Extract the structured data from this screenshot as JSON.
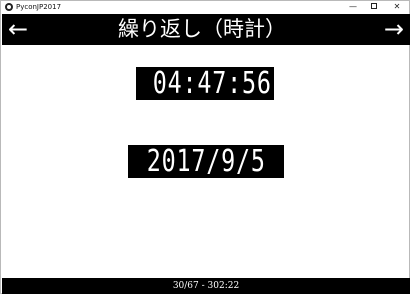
{
  "window": {
    "app_title": "PyconJP2017",
    "icon": "app-icon"
  },
  "header": {
    "prev_arrow": "←",
    "next_arrow": "→",
    "title": "繰り返し（時計）"
  },
  "clock": {
    "time": "04:47:56",
    "date": "2017/9/5"
  },
  "footer": {
    "status": "30/67 - 302:22"
  }
}
